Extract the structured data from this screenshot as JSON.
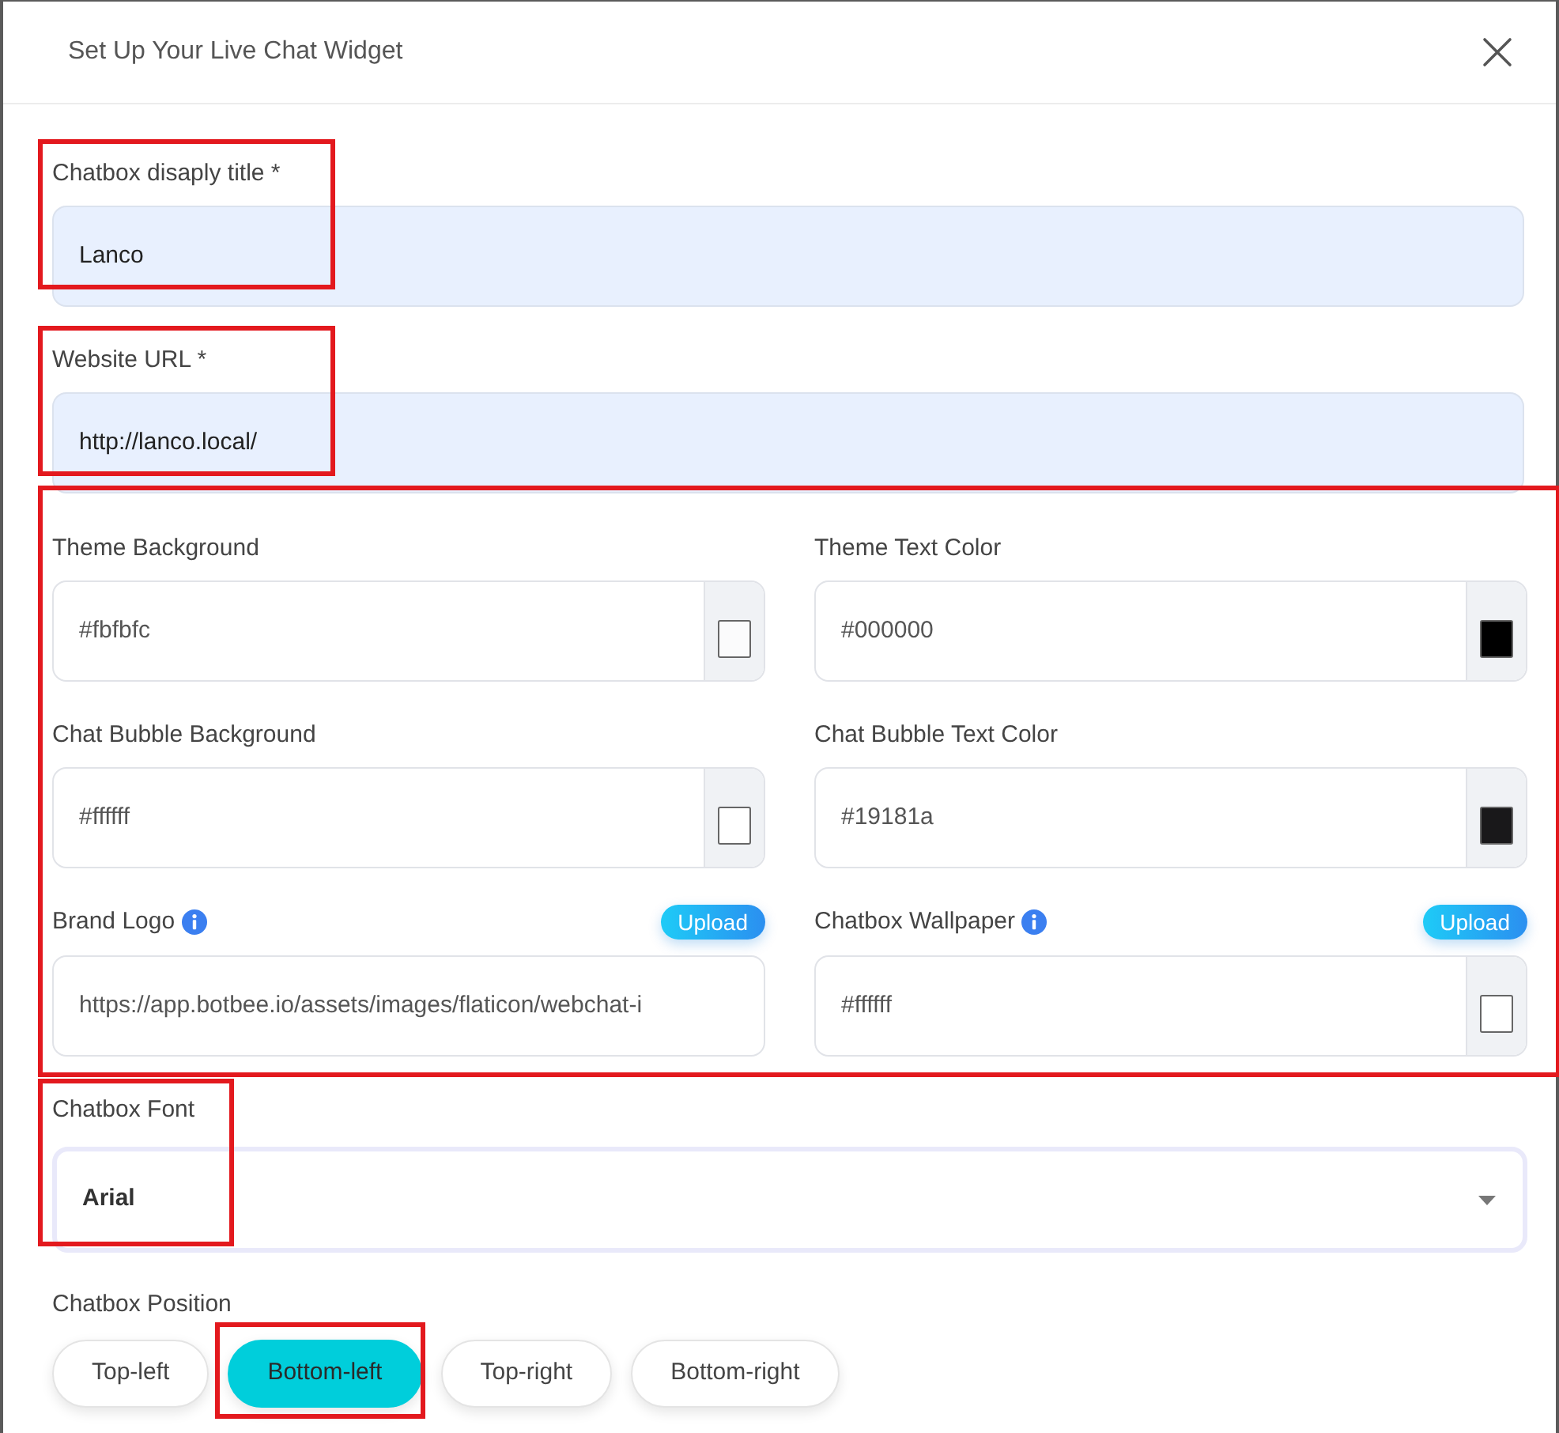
{
  "modal": {
    "title": "Set Up Your Live Chat Widget"
  },
  "fields": [
    {
      "kind": "text",
      "label": "Chatbox disaply title *",
      "value": "Lanco",
      "autofilled": true,
      "highlighted": true
    },
    {
      "kind": "text",
      "label": "Website URL *",
      "value": "http://lanco.local/",
      "autofilled": true,
      "highlighted": true
    }
  ],
  "appearance": {
    "highlighted": true,
    "fields": [
      {
        "kind": "color",
        "label": "Theme Background",
        "value": "#fbfbfc",
        "color": "#fbfbfc"
      },
      {
        "kind": "color",
        "label": "Theme Text Color",
        "value": "#000000",
        "color": "#000000"
      },
      {
        "kind": "color",
        "label": "Chat Bubble Background",
        "value": "#ffffff",
        "color": "#ffffff"
      },
      {
        "kind": "color",
        "label": "Chat Bubble Text Color",
        "value": "#19181a",
        "color": "#19181a"
      },
      {
        "kind": "upload",
        "label": "Brand Logo",
        "info": true,
        "button": "Upload",
        "value": "https://app.botbee.io/assets/images/flaticon/webchat-i"
      },
      {
        "kind": "upload-color",
        "label": "Chatbox Wallpaper",
        "info": true,
        "button": "Upload",
        "value": "#ffffff",
        "color": "#ffffff"
      }
    ]
  },
  "font": {
    "label": "Chatbox Font",
    "value": "Arial",
    "highlighted": true
  },
  "position": {
    "label": "Chatbox Position",
    "options": [
      {
        "label": "Top-left",
        "selected": false,
        "highlighted": false
      },
      {
        "label": "Bottom-left",
        "selected": true,
        "highlighted": true
      },
      {
        "label": "Top-right",
        "selected": false,
        "highlighted": false
      },
      {
        "label": "Bottom-right",
        "selected": false,
        "highlighted": false
      }
    ]
  }
}
